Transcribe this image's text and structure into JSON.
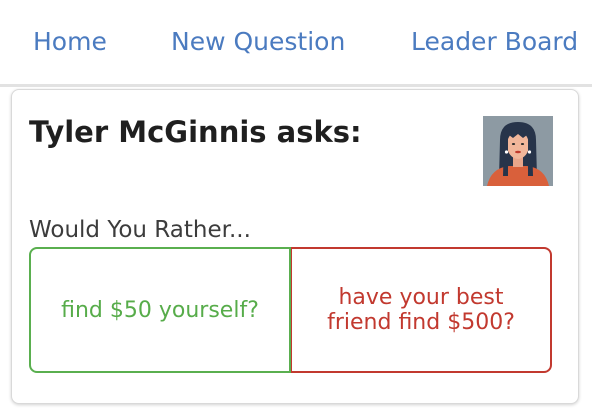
{
  "nav": {
    "items": [
      {
        "label": "Home"
      },
      {
        "label": "New Question"
      },
      {
        "label": "Leader Board"
      }
    ]
  },
  "question": {
    "asker_text": "Tyler McGinnis asks:",
    "prompt": "Would You Rather...",
    "option_one": "find $50 yourself?",
    "option_two": "have your best friend find $500?"
  },
  "colors": {
    "link": "#4b7bc0",
    "option_one": "#57ac4a",
    "option_two": "#c2392f"
  }
}
